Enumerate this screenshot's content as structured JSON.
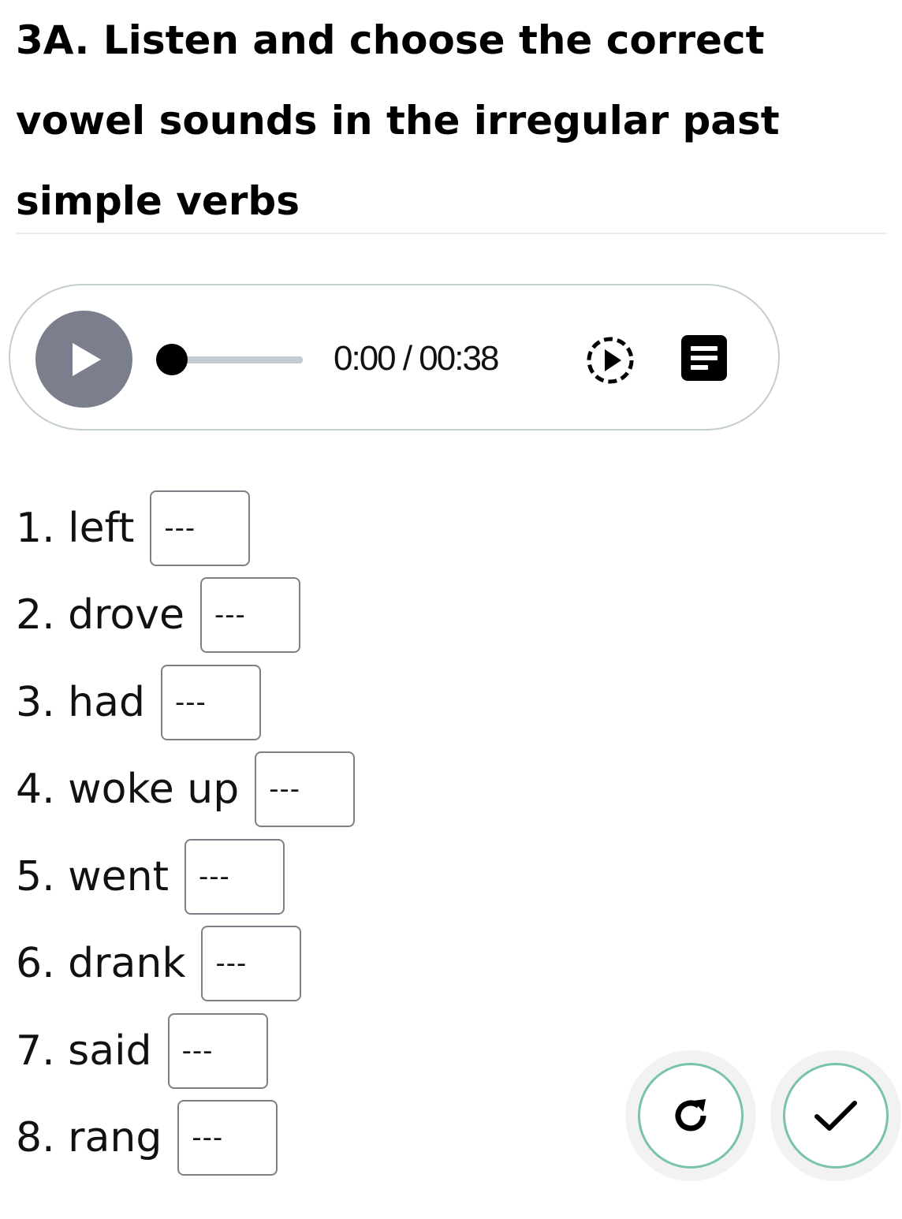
{
  "exercise": {
    "title": "3A. Listen and choose the correct vowel sounds in the irregular past simple verbs"
  },
  "audio_player": {
    "time_display": "0:00 / 00:38",
    "progress": 0,
    "play_icon": "play-icon",
    "speed_icon": "playback-speed-icon",
    "transcript_icon": "transcript-icon",
    "colors": {
      "play_button": "#7a7e8d",
      "track": "#c3cccf",
      "border": "#c3cccf"
    }
  },
  "questions": [
    {
      "label": "1. left",
      "selected": "---"
    },
    {
      "label": "2. drove",
      "selected": "---"
    },
    {
      "label": "3. had",
      "selected": "---"
    },
    {
      "label": "4. woke up",
      "selected": "---"
    },
    {
      "label": "5. went",
      "selected": "---"
    },
    {
      "label": "6. drank",
      "selected": "---"
    },
    {
      "label": "7. said",
      "selected": "---"
    },
    {
      "label": "8. rang",
      "selected": "---"
    }
  ],
  "actions": {
    "reset_icon": "reset-icon",
    "check_icon": "check-icon",
    "ring_color": "#79c3a9"
  }
}
